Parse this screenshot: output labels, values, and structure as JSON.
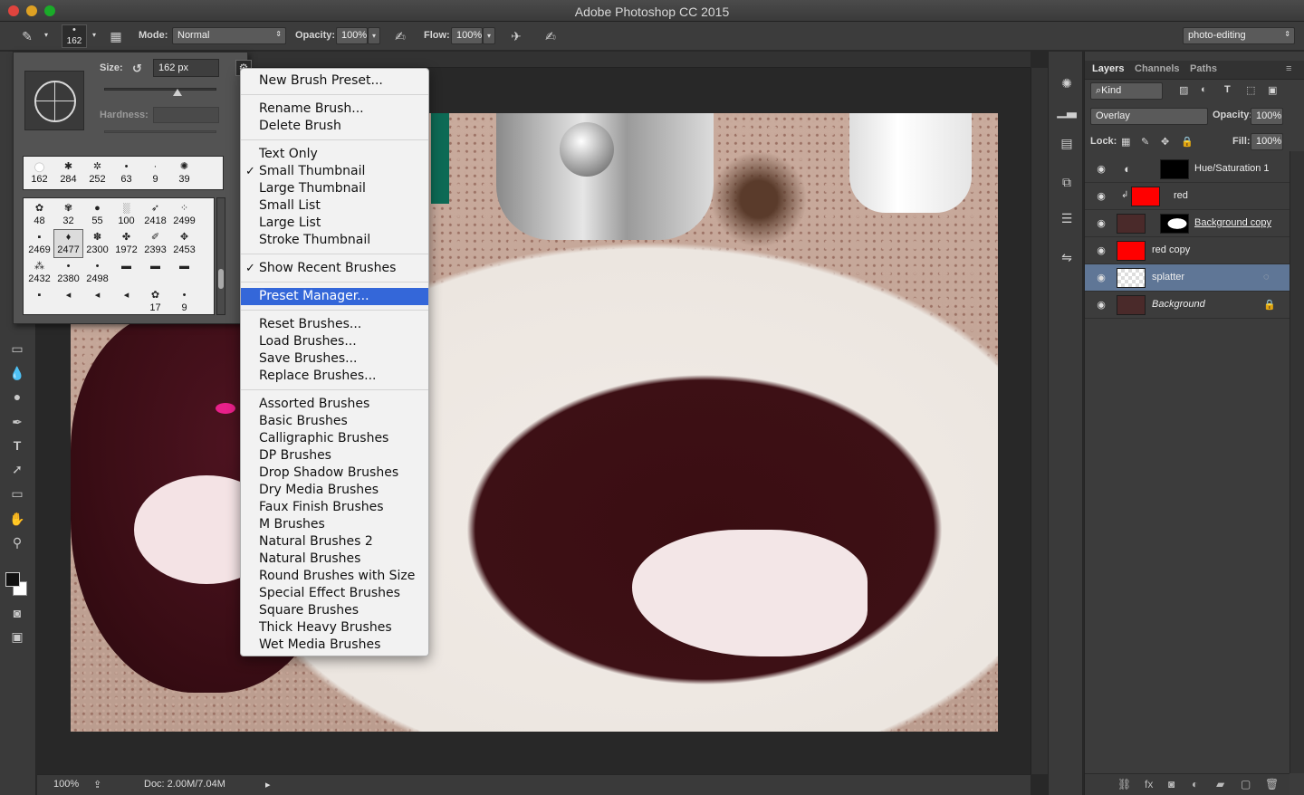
{
  "app": {
    "title": "Adobe Photoshop CC 2015"
  },
  "options_bar": {
    "brush_size": "162",
    "mode_label": "Mode:",
    "mode_value": "Normal",
    "opacity_label": "Opacity:",
    "opacity_value": "100%",
    "flow_label": "Flow:",
    "flow_value": "100%",
    "workspace": "photo-editing"
  },
  "brush_picker": {
    "size_label": "Size:",
    "size_value": "162 px",
    "hardness_label": "Hardness:",
    "recent": [
      {
        "num": "162",
        "glyph": "●"
      },
      {
        "num": "284",
        "glyph": "✱"
      },
      {
        "num": "252",
        "glyph": "✲"
      },
      {
        "num": "63",
        "glyph": "•"
      },
      {
        "num": "9",
        "glyph": "·"
      },
      {
        "num": "39",
        "glyph": "✺"
      }
    ],
    "presets": [
      {
        "num": "48",
        "glyph": "✿"
      },
      {
        "num": "32",
        "glyph": "✾"
      },
      {
        "num": "55",
        "glyph": "●"
      },
      {
        "num": "100",
        "glyph": "░"
      },
      {
        "num": "2418",
        "glyph": "➶"
      },
      {
        "num": "2499",
        "glyph": "⁘"
      },
      {
        "num": "2469",
        "glyph": "▪"
      },
      {
        "num": "2477",
        "glyph": "♦"
      },
      {
        "num": "2300",
        "glyph": "✽"
      },
      {
        "num": "1972",
        "glyph": "✤"
      },
      {
        "num": "2393",
        "glyph": "✐"
      },
      {
        "num": "2453",
        "glyph": "✥"
      },
      {
        "num": "2432",
        "glyph": "⁂"
      },
      {
        "num": "2380",
        "glyph": "•"
      },
      {
        "num": "2498",
        "glyph": "•"
      },
      {
        "num": "",
        "glyph": "▬"
      },
      {
        "num": "",
        "glyph": "▬"
      },
      {
        "num": "",
        "glyph": "▬"
      },
      {
        "num": "",
        "glyph": "▪"
      },
      {
        "num": "",
        "glyph": "◂"
      },
      {
        "num": "",
        "glyph": "◂"
      },
      {
        "num": "",
        "glyph": "◂"
      },
      {
        "num": "17",
        "glyph": "✿"
      },
      {
        "num": "9",
        "glyph": "•"
      }
    ]
  },
  "brush_menu": {
    "items": [
      {
        "label": "New Brush Preset...",
        "checked": false
      },
      {
        "label": "Rename Brush...",
        "checked": false
      },
      {
        "label": "Delete Brush",
        "checked": false
      },
      {
        "label": "Text Only",
        "checked": false
      },
      {
        "label": "Small Thumbnail",
        "checked": true
      },
      {
        "label": "Large Thumbnail",
        "checked": false
      },
      {
        "label": "Small List",
        "checked": false
      },
      {
        "label": "Large List",
        "checked": false
      },
      {
        "label": "Stroke Thumbnail",
        "checked": false
      },
      {
        "label": "Show Recent Brushes",
        "checked": true
      },
      {
        "label": "Preset Manager...",
        "checked": false
      },
      {
        "label": "Reset Brushes...",
        "checked": false
      },
      {
        "label": "Load Brushes...",
        "checked": false
      },
      {
        "label": "Save Brushes...",
        "checked": false
      },
      {
        "label": "Replace Brushes...",
        "checked": false
      },
      {
        "label": "Assorted Brushes",
        "checked": false
      },
      {
        "label": "Basic Brushes",
        "checked": false
      },
      {
        "label": "Calligraphic Brushes",
        "checked": false
      },
      {
        "label": "DP Brushes",
        "checked": false
      },
      {
        "label": "Drop Shadow Brushes",
        "checked": false
      },
      {
        "label": "Dry Media Brushes",
        "checked": false
      },
      {
        "label": "Faux Finish Brushes",
        "checked": false
      },
      {
        "label": "M Brushes",
        "checked": false
      },
      {
        "label": "Natural Brushes 2",
        "checked": false
      },
      {
        "label": "Natural Brushes",
        "checked": false
      },
      {
        "label": "Round Brushes with Size",
        "checked": false
      },
      {
        "label": "Special Effect Brushes",
        "checked": false
      },
      {
        "label": "Square Brushes",
        "checked": false
      },
      {
        "label": "Thick Heavy Brushes",
        "checked": false
      },
      {
        "label": "Wet Media Brushes",
        "checked": false
      }
    ],
    "highlighted": "Preset Manager...",
    "check_glyph": "✓"
  },
  "layers_panel": {
    "tabs": [
      "Layers",
      "Channels",
      "Paths"
    ],
    "filter_kind": "Kind",
    "blend_mode": "Overlay",
    "opacity_label": "Opacity:",
    "opacity_value": "100%",
    "lock_label": "Lock:",
    "fill_label": "Fill:",
    "fill_value": "100%",
    "layers": [
      {
        "name": "Hue/Saturation 1",
        "selected": false,
        "thumb_color": "#000000"
      },
      {
        "name": "red",
        "selected": false,
        "thumb_color": "#ff0000"
      },
      {
        "name": "Background copy",
        "selected": false,
        "thumb_color": "#4a2a2a"
      },
      {
        "name": "red copy",
        "selected": false,
        "thumb_color": "#ff0000"
      },
      {
        "name": "splatter",
        "selected": true,
        "thumb_color": "#ffffff"
      },
      {
        "name": "Background",
        "selected": false,
        "thumb_color": "#4a2a2a"
      }
    ]
  },
  "status_bar": {
    "zoom": "100%",
    "doc": "Doc: 2.00M/7.04M"
  }
}
